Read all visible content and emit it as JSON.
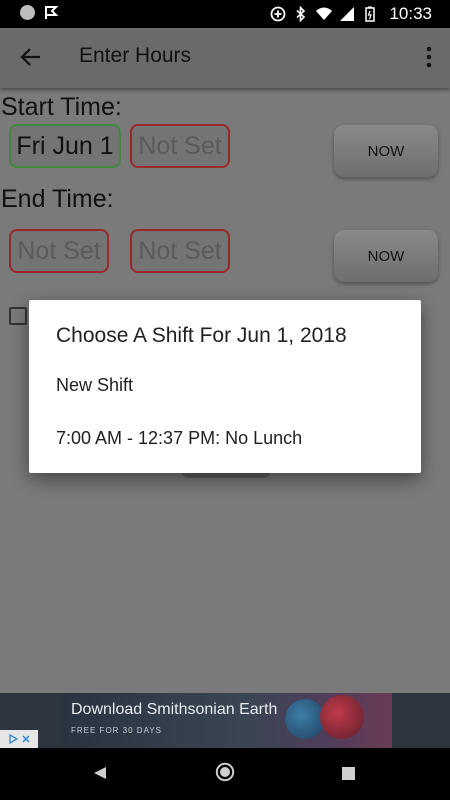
{
  "status_bar": {
    "time": "10:33"
  },
  "app_bar": {
    "title": "Enter Hours"
  },
  "form": {
    "start_label": "Start Time:",
    "start_date": "Fri Jun 1",
    "start_time": "Not Set",
    "start_now": "NOW",
    "end_label": "End Time:",
    "end_date": "Not Set",
    "end_time": "Not Set",
    "end_now": "NOW"
  },
  "dialog": {
    "title": "Choose A Shift For Jun 1, 2018",
    "items": [
      {
        "label": "New Shift"
      },
      {
        "label": "7:00 AM - 12:37 PM: No Lunch"
      }
    ]
  },
  "ad": {
    "title": "Download Smithsonian Earth",
    "subtitle": "FREE FOR 30 DAYS"
  },
  "colors": {
    "dialog_bg": "#ffffff",
    "set_border": "#3f8a3f",
    "unset_border": "#9a2a2a"
  }
}
